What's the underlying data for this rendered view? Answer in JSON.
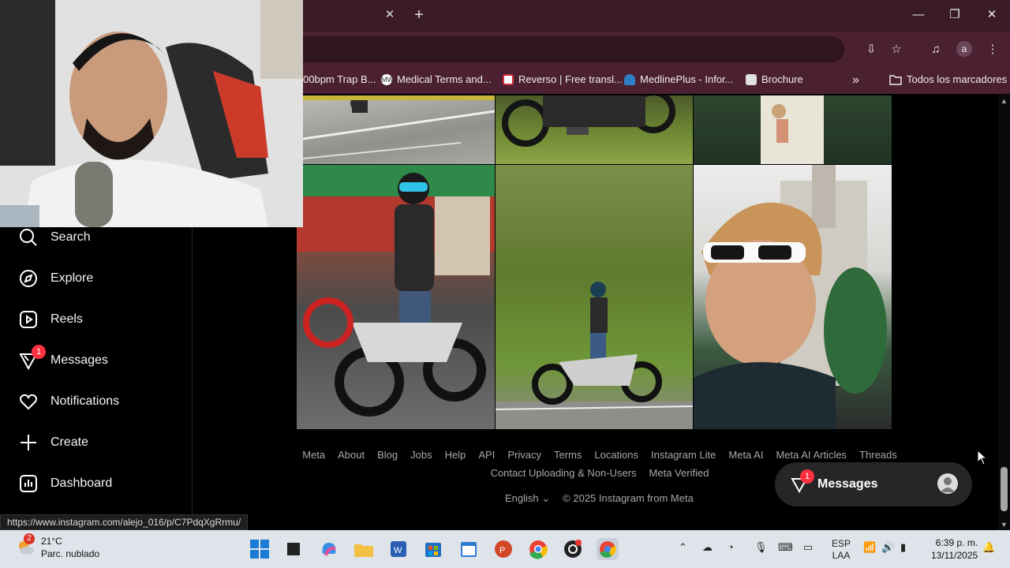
{
  "browser": {
    "tab_close": "✕",
    "new_tab": "+",
    "window_controls": {
      "minimize": "—",
      "maximize": "❐",
      "close": "✕"
    },
    "toolbar_icons": {
      "install": "⇩",
      "star": "☆",
      "media": "♫",
      "menu": "⋮"
    },
    "profile_initial": "a",
    "bookmarks": [
      {
        "label": "00bpm Trap B...",
        "icon": "none"
      },
      {
        "label": "Medical Terms and...",
        "icon": "mw-icon",
        "color": "#ffffff"
      },
      {
        "label": "Reverso | Free transl...",
        "icon": "reverso-icon",
        "color": "#d22d3c"
      },
      {
        "label": "MedlinePlus - Infor...",
        "icon": "medlineplus-icon",
        "color": "#2e7fc4"
      },
      {
        "label": "Brochure",
        "icon": "brochure-icon",
        "color": "#e0e0e0"
      }
    ],
    "bookmarks_overflow": "»",
    "all_bookmarks": "Todos los marcadores"
  },
  "sidebar": {
    "items": [
      {
        "label": "Search",
        "icon": "search-icon"
      },
      {
        "label": "Explore",
        "icon": "compass-icon"
      },
      {
        "label": "Reels",
        "icon": "reels-icon"
      },
      {
        "label": "Messages",
        "icon": "messenger-icon",
        "badge": "1"
      },
      {
        "label": "Notifications",
        "icon": "heart-icon"
      },
      {
        "label": "Create",
        "icon": "plus-icon"
      },
      {
        "label": "Dashboard",
        "icon": "dashboard-icon"
      }
    ]
  },
  "footer": {
    "links": [
      "Meta",
      "About",
      "Blog",
      "Jobs",
      "Help",
      "API",
      "Privacy",
      "Terms",
      "Locations",
      "Instagram Lite",
      "Meta AI",
      "Meta AI Articles",
      "Threads",
      "Contact Uploading & Non-Users",
      "Meta Verified"
    ],
    "language": "English",
    "copyright": "© 2025 Instagram from Meta"
  },
  "messages_pill": {
    "label": "Messages",
    "badge": "1"
  },
  "status_url": "https://www.instagram.com/alejo_016/p/C7PdqXgRrmu/",
  "taskbar": {
    "weather_badge": "2",
    "temperature": "21°C",
    "weather_text": "Parc. nublado",
    "language_line1": "ESP",
    "language_line2": "LAA",
    "time": "6:39 p. m.",
    "date": "13/11/2025"
  },
  "colors": {
    "tabstrip": "#3a1b27",
    "toolbar": "#4b2132",
    "badge": "#ff3040",
    "taskbar": "#dfe3ea"
  }
}
